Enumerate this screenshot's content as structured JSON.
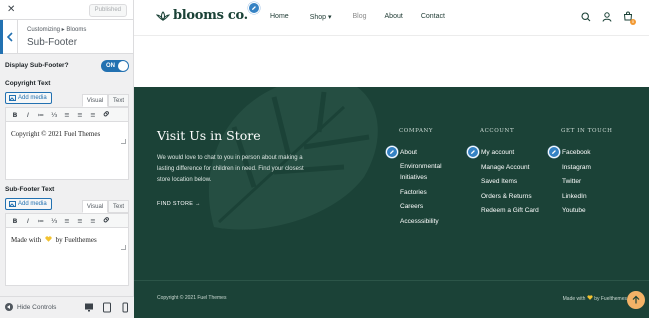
{
  "customizer": {
    "close_glyph": "✕",
    "published_label": "Published",
    "breadcrumb": "Customizing ▸ Blooms",
    "section_title": "Sub-Footer",
    "toggle_label": "Display Sub-Footer?",
    "toggle_state": "ON",
    "copyright_label": "Copyright Text",
    "subfooter_label": "Sub-Footer Text",
    "add_media_label": "Add media",
    "tab_visual": "Visual",
    "tab_text": "Text",
    "toolbar": [
      "B",
      "I",
      "≔",
      "⅓",
      "≡",
      "≡",
      "≡",
      "🔗"
    ],
    "copyright_content": "Copyright © 2021 Fuel Themes",
    "subfooter_content_before": "Made with",
    "subfooter_content_after": "by Fuelthemes",
    "hide_controls_label": "Hide Controls"
  },
  "site": {
    "logo_text": "blooms co.",
    "nav": [
      "Home",
      "Shop ▾",
      "Blog",
      "About",
      "Contact"
    ],
    "cart_count": "0",
    "visit_title": "Visit Us in Store",
    "visit_text": "We would love to chat to you in person about making a lasting difference for children in need. Find your closest store location below.",
    "find_store": "FIND STORE →",
    "columns": [
      {
        "title": "COMPANY",
        "items": [
          "About",
          "Environmental Initiatives",
          "Factories",
          "Careers",
          "Accesssibility"
        ]
      },
      {
        "title": "ACCOUNT",
        "items": [
          "My account",
          "Manage Account",
          "Saved Items",
          "Orders & Returns",
          "Redeem a Gift Card"
        ]
      },
      {
        "title": "GET IN TOUCH",
        "items": [
          "Facebook",
          "Instagram",
          "Twitter",
          "LinkedIn",
          "Youtube"
        ]
      }
    ],
    "copyright": "Copyright © 2021 Fuel Themes",
    "madewith_before": "Made with",
    "madewith_after": "by Fuelthemes"
  },
  "colors": {
    "accent": "#2271b1",
    "footer_bg": "#1b4237",
    "heart": "#f2c230",
    "scroll_top": "#f3b267"
  }
}
